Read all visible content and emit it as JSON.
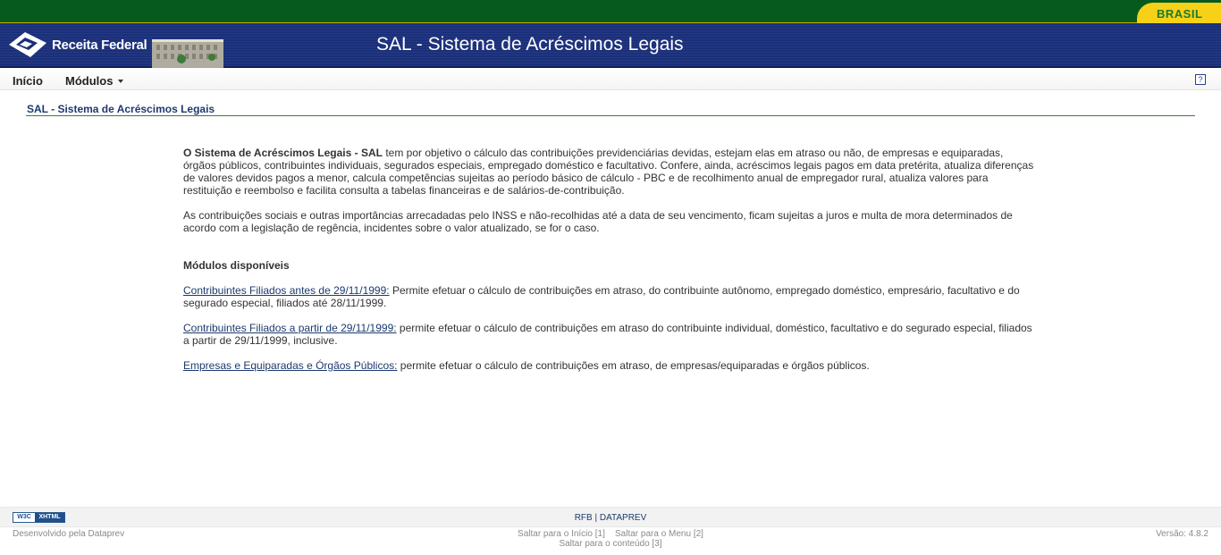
{
  "gov_bar": {
    "brasil_label": "BRASIL"
  },
  "header": {
    "logo_text": "Receita Federal",
    "title": "SAL - Sistema de Acréscimos Legais"
  },
  "menu": {
    "inicio": "Início",
    "modulos": "Módulos",
    "help": "?"
  },
  "page": {
    "heading": "SAL - Sistema de Acréscimos Legais",
    "intro_bold": "O Sistema de Acréscimos Legais - SAL",
    "intro_rest": " tem por objetivo o cálculo das contribuições previdenciárias devidas, estejam elas em atraso ou não, de empresas e equiparadas, órgãos públicos, contribuintes individuais, segurados especiais, empregado doméstico e facultativo. Confere, ainda, acréscimos legais pagos em data pretérita, atualiza diferenças de valores devidos pagos a menor, calcula competências sujeitas ao período básico de cálculo - PBC e de recolhimento anual de empregador rural, atualiza valores para restituição e reembolso e facilita consulta a tabelas financeiras e de salários-de-contribuição.",
    "paragraph2": "As contribuições sociais e outras importâncias arrecadadas pelo INSS e não-recolhidas até a data de seu vencimento, ficam sujeitas a juros e multa de mora determinados de acordo com a legislação de regência, incidentes sobre o valor atualizado, se for o caso.",
    "modules_title": "Módulos disponíveis",
    "modules": [
      {
        "link": "Contribuintes Filiados antes de 29/11/1999:",
        "desc": " Permite efetuar o cálculo de contribuições em atraso, do contribuinte autônomo, empregado doméstico, empresário, facultativo e do segurado especial, filiados até 28/11/1999."
      },
      {
        "link": "Contribuintes Filiados a partir de 29/11/1999:",
        "desc": " permite efetuar o cálculo de contribuições em atraso do contribuinte individual, doméstico, facultativo e do segurado especial, filiados a partir de 29/11/1999, inclusive."
      },
      {
        "link": "Empresas e Equiparadas e Órgãos Públicos:",
        "desc": " permite efetuar o cálculo de contribuições em atraso, de empresas/equiparadas e órgãos públicos."
      }
    ]
  },
  "footer": {
    "w3c": "W3C",
    "xhtml": "XHTML",
    "rfb": "RFB",
    "separator": " | ",
    "dataprev": "DATAPREV",
    "developed_by": "Desenvolvido pela Dataprev",
    "skip_inicio": "Saltar para o Início [1]",
    "skip_menu": "Saltar para o Menu [2]",
    "skip_conteudo": "Saltar para o conteúdo [3]",
    "version": "Versão: 4.8.2"
  }
}
